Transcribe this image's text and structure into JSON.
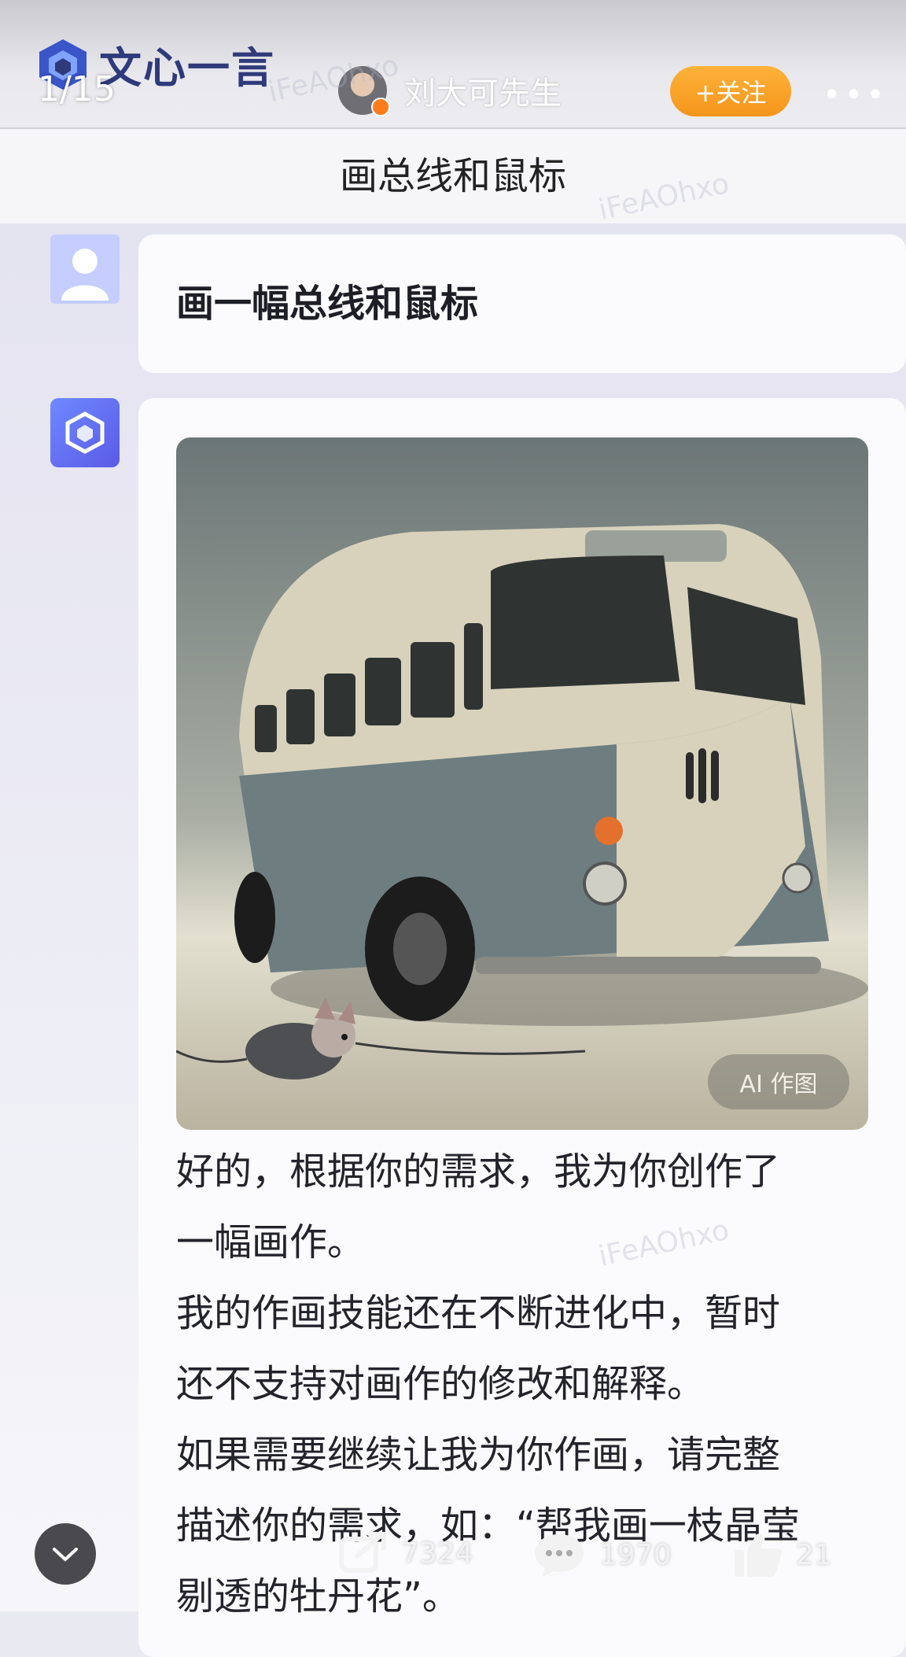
{
  "header": {
    "brand": "文心一言",
    "counter": "1/15",
    "author": "刘大可先生",
    "follow_label": "+关注",
    "more_label": "•••"
  },
  "title": "画总线和鼠标",
  "chat": {
    "user_message": "画一幅总线和鼠标",
    "image_tag": "AI 作图",
    "reply_lines": [
      "好的，根据你的需求，我为你创作了",
      "一幅画作。",
      "我的作画技能还在不断进化中，暂时",
      "还不支持对画作的修改和解释。",
      "如果需要继续让我为你作画，请完整",
      "描述你的需求，如：“帮我画一枝晶莹",
      "剔透的牡丹花”。"
    ]
  },
  "watermark": "iFeAOhxo",
  "stats": {
    "shares": "7324",
    "comments": "1970",
    "likes": "21"
  },
  "colors": {
    "follow": "#f4951b",
    "brand_blue": "#2f3a7a",
    "bot_avatar": "#5a5ae6"
  },
  "icons": {
    "logo": "wenxin-logo-icon",
    "share": "share-icon",
    "comment": "comment-icon",
    "like": "thumbs-up-icon",
    "collapse": "chevron-down-icon"
  }
}
